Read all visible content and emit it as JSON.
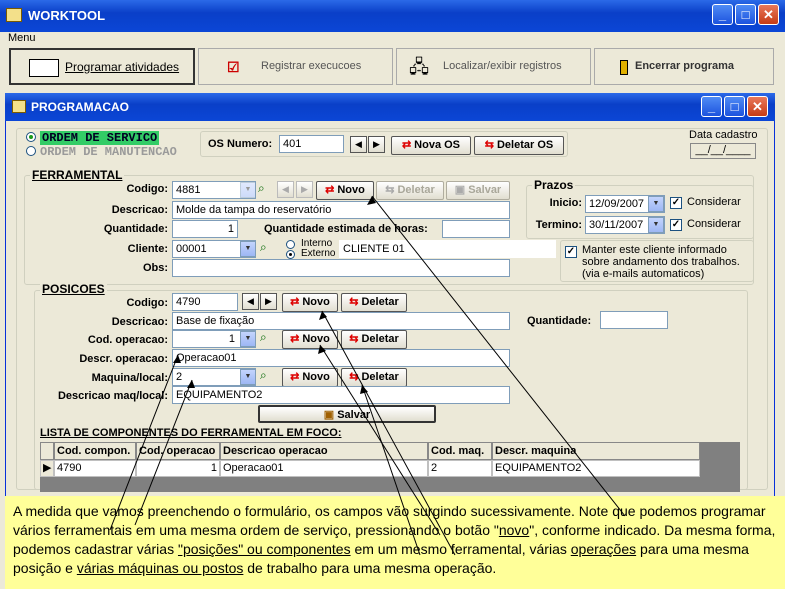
{
  "app": {
    "title": "WORKTOOL",
    "menu": "Menu"
  },
  "toolbar": {
    "programar": "Programar atividades",
    "registrar": "Registrar execucoes",
    "localizar": "Localizar/exibir registros",
    "encerrar": "Encerrar programa"
  },
  "window": {
    "title": "PROGRAMACAO"
  },
  "os": {
    "radio_servico": "ORDEM DE SERVICO",
    "radio_manutencao": "ORDEM DE MANUTENCAO",
    "numero_label": "OS Numero:",
    "numero_value": "401",
    "nova_os": "Nova OS",
    "deletar_os": "Deletar OS",
    "data_cadastro_label": "Data cadastro",
    "data_cadastro_value": "__/__/____"
  },
  "ferramental": {
    "title": "FERRAMENTAL",
    "codigo_label": "Codigo:",
    "codigo_value": "4881",
    "novo": "Novo",
    "deletar": "Deletar",
    "salvar": "Salvar",
    "descricao_label": "Descricao:",
    "descricao_value": "Molde da tampa do reservatório",
    "quantidade_label": "Quantidade:",
    "quantidade_value": "1",
    "qtd_horas_label": "Quantidade estimada de horas:",
    "qtd_horas_value": "",
    "cliente_label": "Cliente:",
    "cliente_value": "00001",
    "interno": "Interno",
    "externo": "Externo",
    "cliente_nome": "CLIENTE 01",
    "obs_label": "Obs:",
    "obs_value": ""
  },
  "prazos": {
    "title": "Prazos",
    "inicio_label": "Inicio:",
    "inicio_value": "12/09/2007",
    "termino_label": "Termino:",
    "termino_value": "30/11/2007",
    "considerar": "Considerar"
  },
  "manter_cliente": "Manter este cliente informado sobre andamento dos trabalhos. (via e-mails automaticos)",
  "posicoes": {
    "title": "POSICOES",
    "codigo_label": "Codigo:",
    "codigo_value": "4790",
    "novo": "Novo",
    "deletar": "Deletar",
    "descricao_label": "Descricao:",
    "descricao_value": "Base de fixação",
    "quantidade_label": "Quantidade:",
    "quantidade_value": "",
    "cod_operacao_label": "Cod. operacao:",
    "cod_operacao_value": "1",
    "descr_operacao_label": "Descr. operacao:",
    "descr_operacao_value": "Operacao01",
    "maquina_label": "Maquina/local:",
    "maquina_value": "2",
    "descricao_maq_label": "Descricao maq/local:",
    "descricao_maq_value": "EQUIPAMENTO2",
    "salvar": "Salvar"
  },
  "lista": {
    "title": "LISTA DE COMPONENTES DO FERRAMENTAL EM FOCO:",
    "headers": [
      "Cod. compon.",
      "Cod. operacao",
      "Descricao operacao",
      "Cod. maq.",
      "Descr. maquina"
    ],
    "rows": [
      [
        "4790",
        "1",
        "Operacao01",
        "2",
        "EQUIPAMENTO2"
      ]
    ]
  },
  "callout": {
    "p1": "A medida que vamos preenchendo o formulário, os campos vão surgindo sucessivamente. Note que podemos programar vários ferramentais em uma mesma ordem de serviço, pressionando o botão \"",
    "novo": "novo",
    "p2": "\", conforme indicado. Da mesma forma, podemos cadastrar várias ",
    "posicoes": "\"posições\" ou componentes",
    "p3": " em um mesmo ferramental, várias ",
    "operacoes": "operações",
    "p4": " para uma mesma posição e ",
    "maquinas": "várias máquinas ou postos",
    "p5": " de trabalho para uma mesma operação."
  }
}
